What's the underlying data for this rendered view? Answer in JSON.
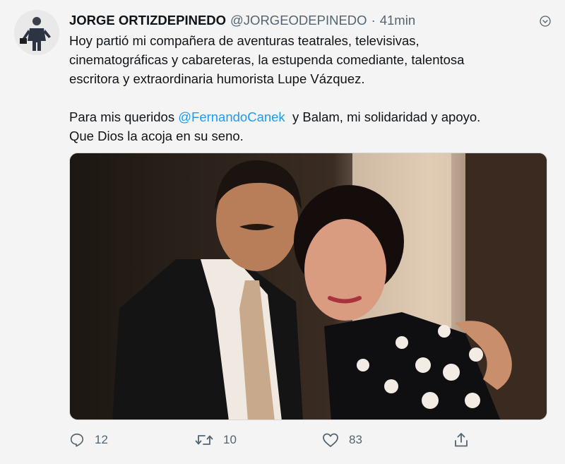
{
  "tweet": {
    "display_name": "JORGE ORTIZDEPINEDO",
    "handle": "@JORGEODEPINEDO",
    "separator": "·",
    "time": "41min",
    "text_line1": "Hoy partió mi compañera de aventuras teatrales, televisivas,",
    "text_line2": "cinematográficas y cabareteras, la estupenda comediante, talentosa",
    "text_line3": "escritora y extraordinaria humorista Lupe Vázquez.",
    "text_para2_pre": "Para mis queridos ",
    "mention": "@FernandoCanek",
    "text_para2_post": "  y Balam, mi solidaridad y apoyo.",
    "text_line6": "Que Dios la acoja en su seno."
  },
  "actions": {
    "reply_count": "12",
    "retweet_count": "10",
    "like_count": "83"
  },
  "icons": {
    "avatar": "profile-photo",
    "more": "chevron-down-icon",
    "reply": "reply-icon",
    "retweet": "retweet-icon",
    "like": "heart-icon",
    "share": "share-icon"
  },
  "colors": {
    "link": "#1d9bf0",
    "secondary_text": "#536471",
    "background": "#f4f4f4"
  }
}
